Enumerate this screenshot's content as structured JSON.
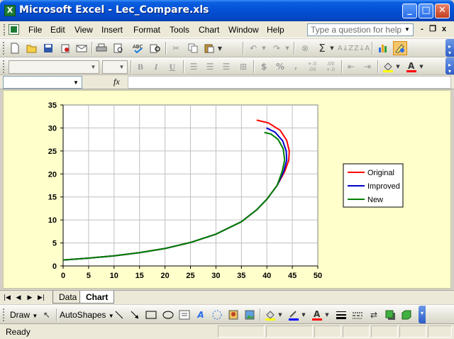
{
  "window": {
    "title": "Microsoft Excel - Lec_Compare.xls",
    "app_icon": "X",
    "minimize": "_",
    "maximize": "□",
    "close": "✕"
  },
  "menubar": {
    "items": [
      {
        "label": "File"
      },
      {
        "label": "Edit"
      },
      {
        "label": "View"
      },
      {
        "label": "Insert"
      },
      {
        "label": "Format"
      },
      {
        "label": "Tools"
      },
      {
        "label": "Chart"
      },
      {
        "label": "Window"
      },
      {
        "label": "Help"
      }
    ],
    "question_placeholder": "Type a question for help",
    "mdi_min": "-",
    "mdi_restore": "❐",
    "mdi_close": "x"
  },
  "formatting": {
    "bold": "B",
    "italic": "I",
    "underline": "U",
    "currency": "$",
    "percent": "%",
    "increase_decimal": "+.0 .00",
    "decrease_decimal": ".00 +.0"
  },
  "formula_bar": {
    "fx": "fx"
  },
  "chart_data": {
    "type": "line",
    "title": "",
    "xlabel": "",
    "ylabel": "",
    "xlim": [
      0,
      50
    ],
    "ylim": [
      0,
      35
    ],
    "x_ticks": [
      0,
      5,
      10,
      15,
      20,
      25,
      30,
      35,
      40,
      45,
      50
    ],
    "y_ticks": [
      0,
      5,
      10,
      15,
      20,
      25,
      30,
      35
    ],
    "grid": true,
    "legend_position": "right",
    "series": [
      {
        "name": "Original",
        "color": "#ff0000",
        "points": [
          [
            0,
            1.3
          ],
          [
            5,
            1.7
          ],
          [
            10,
            2.2
          ],
          [
            15,
            2.9
          ],
          [
            20,
            3.8
          ],
          [
            25,
            5.1
          ],
          [
            30,
            6.9
          ],
          [
            35,
            9.6
          ],
          [
            38,
            12.2
          ],
          [
            40,
            14.5
          ],
          [
            42,
            17.5
          ],
          [
            43.5,
            20.5
          ],
          [
            44.3,
            23
          ],
          [
            44.4,
            25
          ],
          [
            43.9,
            27.3
          ],
          [
            42.6,
            29.5
          ],
          [
            40.3,
            31.1
          ],
          [
            38,
            31.7
          ]
        ]
      },
      {
        "name": "Improved",
        "color": "#0000cc",
        "points": [
          [
            0,
            1.3
          ],
          [
            5,
            1.7
          ],
          [
            10,
            2.2
          ],
          [
            15,
            2.9
          ],
          [
            20,
            3.8
          ],
          [
            25,
            5.1
          ],
          [
            30,
            6.9
          ],
          [
            35,
            9.6
          ],
          [
            38,
            12.2
          ],
          [
            40,
            14.5
          ],
          [
            42,
            17.5
          ],
          [
            43.3,
            20.5
          ],
          [
            43.9,
            23
          ],
          [
            43.8,
            25
          ],
          [
            43.1,
            27.2
          ],
          [
            41.6,
            29.1
          ],
          [
            39.9,
            30
          ]
        ]
      },
      {
        "name": "New",
        "color": "#008000",
        "points": [
          [
            0,
            1.3
          ],
          [
            5,
            1.7
          ],
          [
            10,
            2.2
          ],
          [
            15,
            2.9
          ],
          [
            20,
            3.8
          ],
          [
            25,
            5.1
          ],
          [
            30,
            6.9
          ],
          [
            35,
            9.6
          ],
          [
            38,
            12.2
          ],
          [
            40,
            14.5
          ],
          [
            42,
            17.5
          ],
          [
            43,
            20.5
          ],
          [
            43.5,
            23
          ],
          [
            43.2,
            25.5
          ],
          [
            42.2,
            27.5
          ],
          [
            40.8,
            28.7
          ],
          [
            39.5,
            29
          ]
        ]
      }
    ]
  },
  "sheet_tabs": {
    "nav_first": "|◀",
    "nav_prev": "◀",
    "nav_next": "▶",
    "nav_last": "▶|",
    "tabs": [
      {
        "label": "Data"
      },
      {
        "label": "Chart"
      }
    ],
    "active": "Chart"
  },
  "drawing": {
    "draw_label": "Draw",
    "autoshapes_label": "AutoShapes"
  },
  "status": {
    "text": "Ready"
  }
}
